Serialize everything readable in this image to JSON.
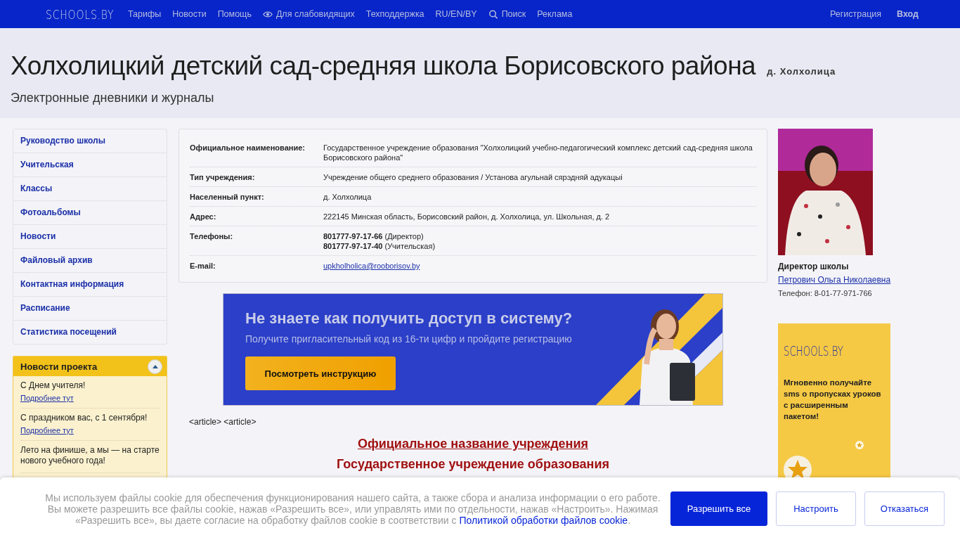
{
  "topbar": {
    "logo": "SCHOOLS.BY",
    "nav": [
      {
        "label": "Тарифы",
        "kind": "plain"
      },
      {
        "label": "Новости",
        "kind": "plain"
      },
      {
        "label": "Помощь",
        "kind": "plain"
      },
      {
        "label": "Для слабовидящих",
        "kind": "eye"
      },
      {
        "label": "Техподдержка",
        "kind": "plain"
      },
      {
        "label": "RU/EN/BY",
        "kind": "plain"
      },
      {
        "label": "Поиск",
        "kind": "search"
      },
      {
        "label": "Реклама",
        "kind": "plain"
      }
    ],
    "account": [
      {
        "label": "Регистрация",
        "bold": false
      },
      {
        "label": "Вход",
        "bold": true
      }
    ]
  },
  "header": {
    "title": "Холхолицкий детский сад-средняя школа Борисовского района",
    "locality": "д. Холхолица",
    "subtitle": "Электронные дневники и журналы"
  },
  "sidebar": {
    "menu": [
      "Руководство школы",
      "Учительская",
      "Классы",
      "Фотоальбомы",
      "Новости",
      "Файловый архив",
      "Контактная информация",
      "Расписание",
      "Статистика посещений"
    ],
    "news_panel": {
      "title": "Новости проекта",
      "expanded": true,
      "items": [
        {
          "text": "С Днем учителя!",
          "link": "Подробнее тут"
        },
        {
          "text": "С праздником вас, с 1 сентября!",
          "link": "Подробнее тут"
        },
        {
          "text": "Лето на финише, а мы — на старте нового учебного года!"
        }
      ]
    }
  },
  "info": {
    "rows": [
      {
        "kind": "text",
        "label": "Официальное наименование:",
        "value": "Государственное учреждение образования \"Холхолицкий учебно-педагогический комплекс детский сад-средняя школа Борисовского района\""
      },
      {
        "kind": "text",
        "label": "Тип учреждения:",
        "value": "Учреждение общего среднего образования / Установа агульнай сярэдняй адукацыі"
      },
      {
        "kind": "text",
        "label": "Населенный пункт:",
        "value": "д. Холхолица"
      },
      {
        "kind": "text",
        "label": "Адрес:",
        "value": "222145 Минская область, Борисовский район, д. Холхолица, ул. Школьная, д. 2"
      },
      {
        "kind": "phones",
        "label": "Телефоны:",
        "phones": [
          {
            "number": "801777-97-17-66",
            "note": "(Директор)"
          },
          {
            "number": "801777-97-17-40",
            "note": "(Учительская)"
          }
        ]
      },
      {
        "kind": "link",
        "label": "E-mail:",
        "value": "upkholholica@rooborisov.by"
      }
    ]
  },
  "promo_banner": {
    "title": "Не знаете как получить доступ в систему?",
    "subtitle": "Получите пригласительный код из 16-ти цифр и пройдите регистрацию",
    "button": "Посмотреть инструкцию"
  },
  "article": {
    "tags": "<article> <article>",
    "heading": "Официальное название учреждения",
    "subheading": "Государственное учреждение образования"
  },
  "director": {
    "role": "Директор школы",
    "name": "Петрович Ольга Николаевна",
    "phone": "Телефон: 8-01-77-971-766"
  },
  "side_ad": {
    "logo": "SCHOOLS.BY",
    "text": "Мгновенно получайте sms о пропусках уроков с расширенным пакетом!"
  },
  "cookie_bar": {
    "text": "Мы используем файлы cookie для обеспечения функционирования нашего сайта, а также сбора и анализа информации о его работе. Вы можете разрешить все файлы cookie, нажав «Разрешить все», или управлять ими по отдельности, нажав «Настроить». Нажимая «Разрешить все», вы даете согласие на обработку файлов cookie в соответствии с ",
    "link": "Политикой обработки файлов cookie",
    "after": ".",
    "buttons": [
      {
        "label": "Разрешить все",
        "primary": true
      },
      {
        "label": "Настроить",
        "primary": false
      },
      {
        "label": "Отказаться",
        "primary": false
      }
    ]
  }
}
